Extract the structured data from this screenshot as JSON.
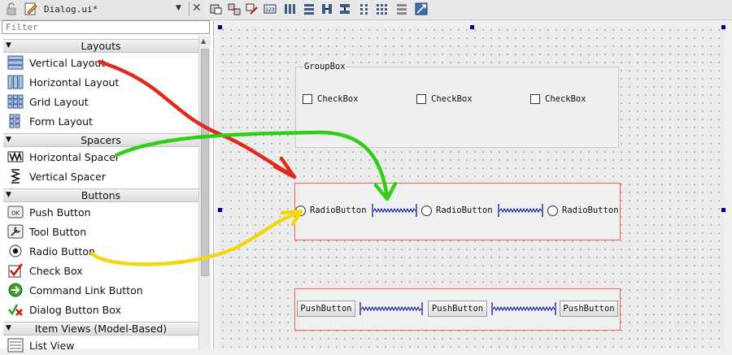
{
  "widget_box": {
    "file_name": "Dialog.ui*",
    "filter_placeholder": "Filter",
    "categories": [
      {
        "label": "Layouts",
        "items": [
          {
            "label": "Vertical Layout",
            "icon": "vertical-layout-icon"
          },
          {
            "label": "Horizontal Layout",
            "icon": "horizontal-layout-icon"
          },
          {
            "label": "Grid Layout",
            "icon": "grid-layout-icon"
          },
          {
            "label": "Form Layout",
            "icon": "form-layout-icon"
          }
        ]
      },
      {
        "label": "Spacers",
        "items": [
          {
            "label": "Horizontal Spacer",
            "icon": "horizontal-spacer-icon"
          },
          {
            "label": "Vertical Spacer",
            "icon": "vertical-spacer-icon"
          }
        ]
      },
      {
        "label": "Buttons",
        "items": [
          {
            "label": "Push Button",
            "icon": "push-button-icon"
          },
          {
            "label": "Tool Button",
            "icon": "tool-button-icon"
          },
          {
            "label": "Radio Button",
            "icon": "radio-button-icon"
          },
          {
            "label": "Check Box",
            "icon": "check-box-icon"
          },
          {
            "label": "Command Link Button",
            "icon": "command-link-icon"
          },
          {
            "label": "Dialog Button Box",
            "icon": "dialog-button-box-icon"
          }
        ]
      },
      {
        "label": "Item Views (Model-Based)",
        "items": [
          {
            "label": "List View",
            "icon": "list-view-icon"
          }
        ]
      }
    ]
  },
  "form": {
    "groupbox": {
      "title": "GroupBox",
      "checkboxes": [
        "CheckBox",
        "CheckBox",
        "CheckBox"
      ]
    },
    "radio_buttons": [
      "RadioButton",
      "RadioButton",
      "RadioButton"
    ],
    "push_buttons": [
      "PushButton",
      "PushButton",
      "PushButton"
    ]
  },
  "colors": {
    "layout_border": "#ff5a5a",
    "handle": "#00007f",
    "arrow_red": "#e02a1c",
    "arrow_green": "#2fcf16",
    "arrow_yellow": "#f6d60e",
    "spacer": "#0b0b9c"
  }
}
